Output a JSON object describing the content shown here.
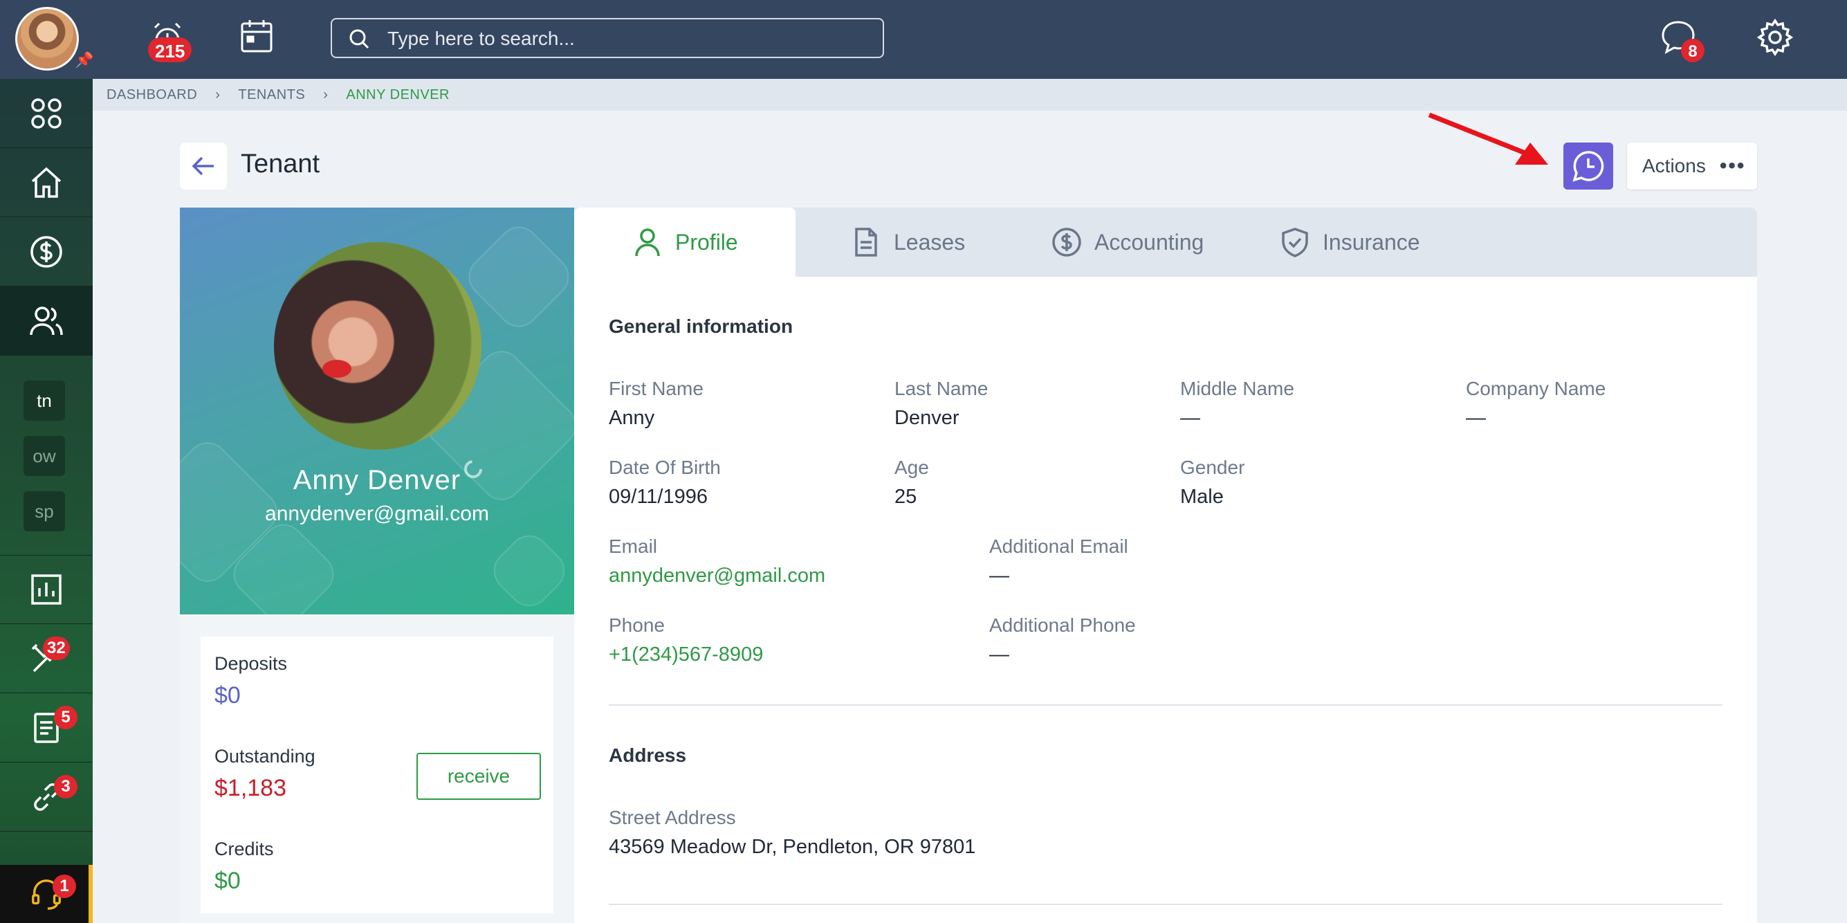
{
  "topbar": {
    "alarm_badge": "215",
    "search_placeholder": "Type here to search...",
    "chat_badge": "8"
  },
  "sidebar": {
    "codes": [
      "tn",
      "ow",
      "sp"
    ],
    "badges": {
      "maintenance": "32",
      "documents": "5",
      "links": "3",
      "support": "1"
    }
  },
  "breadcrumb": [
    "DASHBOARD",
    "TENANTS",
    "ANNY DENVER"
  ],
  "header": {
    "title": "Tenant",
    "actions_label": "Actions"
  },
  "profile": {
    "name": "Anny Denver",
    "email": "annydenver@gmail.com"
  },
  "finance": {
    "deposits_label": "Deposits",
    "deposits_value": "$0",
    "outstanding_label": "Outstanding",
    "outstanding_value": "$1,183",
    "credits_label": "Credits",
    "credits_value": "$0",
    "receive_label": "receive"
  },
  "tabs": [
    "Profile",
    "Leases",
    "Accounting",
    "Insurance"
  ],
  "general": {
    "title": "General information",
    "first_name_label": "First Name",
    "first_name": "Anny",
    "last_name_label": "Last Name",
    "last_name": "Denver",
    "middle_name_label": "Middle Name",
    "middle_name": "—",
    "company_name_label": "Company Name",
    "company_name": "—",
    "dob_label": "Date Of Birth",
    "dob": "09/11/1996",
    "age_label": "Age",
    "age": "25",
    "gender_label": "Gender",
    "gender": "Male",
    "email_label": "Email",
    "email": "annydenver@gmail.com",
    "add_email_label": "Additional Email",
    "add_email": "—",
    "phone_label": "Phone",
    "phone": "+1(234)567-8909",
    "add_phone_label": "Additional Phone",
    "add_phone": "—"
  },
  "address": {
    "title": "Address",
    "street_label": "Street Address",
    "street": "43569 Meadow Dr, Pendleton, OR 97801"
  },
  "colors": {
    "accent_green": "#2f9a45",
    "accent_purple": "#6a5ed8",
    "danger_red": "#c81e2a",
    "deposit_blue": "#5a63c9"
  }
}
